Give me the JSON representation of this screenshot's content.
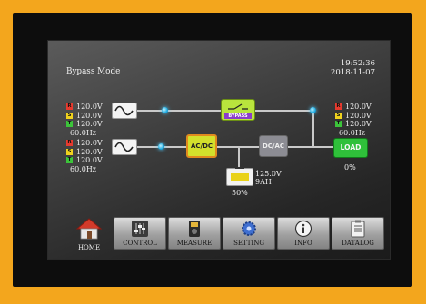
{
  "header": {
    "mode": "Bypass Mode",
    "time": "19:52:36",
    "date": "2018-11-07"
  },
  "input_bypass": {
    "r": "120.0V",
    "s": "120.0V",
    "t": "120.0V",
    "freq": "60.0Hz"
  },
  "input_main": {
    "r": "120.0V",
    "s": "120.0V",
    "t": "120.0V",
    "freq": "60.0Hz"
  },
  "output": {
    "r": "120.0V",
    "s": "120.0V",
    "t": "120.0V",
    "freq": "60.0Hz",
    "load_pct": "0%"
  },
  "battery": {
    "voltage": "125.0V",
    "capacity": "9AH",
    "percent": "50%"
  },
  "phase_tags": {
    "r": "R",
    "s": "S",
    "t": "T"
  },
  "modules": {
    "bypass": "BYPASS",
    "acdc": "AC/DC",
    "dcac": "DC/AC",
    "load": "LOAD"
  },
  "nav": {
    "home": "HOME",
    "control": "CONTROL",
    "measure": "MEASURE",
    "setting": "SETTING",
    "info": "INFO",
    "datalog": "DATALOG"
  },
  "colors": {
    "frame": "#f3a61d",
    "bypass_module": "#b9e43d",
    "load_module": "#2fc03a",
    "flow_dot": "#17a8e0"
  }
}
